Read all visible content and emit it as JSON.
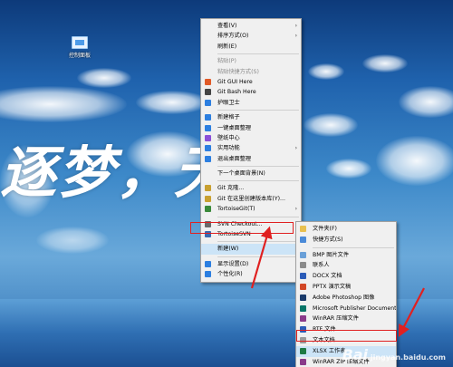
{
  "desktop": {
    "icon_label": "控制面板",
    "calligraphy_text": "逐梦，无"
  },
  "context_menu": [
    {
      "label": "查看(V)",
      "icon": "",
      "has_submenu": true
    },
    {
      "label": "排序方式(O)",
      "icon": "",
      "has_submenu": true
    },
    {
      "label": "刷新(E)",
      "icon": ""
    },
    {
      "type": "separator"
    },
    {
      "label": "粘贴(P)",
      "icon": "",
      "disabled": true
    },
    {
      "label": "粘贴快捷方式(S)",
      "icon": "",
      "disabled": true
    },
    {
      "label": "Git GUI Here",
      "icon": "git-gui-icon",
      "color": "#e05a28"
    },
    {
      "label": "Git Bash Here",
      "icon": "git-bash-icon",
      "color": "#444444"
    },
    {
      "label": "护眼卫士",
      "icon": "eye-guard-icon",
      "color": "#2d7fe0"
    },
    {
      "type": "separator"
    },
    {
      "label": "新建格子",
      "icon": "grid-icon",
      "color": "#2d7fe0"
    },
    {
      "label": "一键桌面整理",
      "icon": "desktop-organize-icon",
      "color": "#2d7fe0"
    },
    {
      "label": "壁纸中心",
      "icon": "wallpaper-icon",
      "color": "#8a4fd8"
    },
    {
      "label": "实用功能",
      "icon": "tools-icon",
      "color": "#2d7fe0",
      "has_submenu": true
    },
    {
      "label": "退出桌面整理",
      "icon": "exit-icon",
      "color": "#2d7fe0"
    },
    {
      "type": "separator"
    },
    {
      "label": "下一个桌面背景(N)",
      "icon": ""
    },
    {
      "type": "separator"
    },
    {
      "label": "Git 克隆...",
      "icon": "git-clone-icon",
      "color": "#c8a030"
    },
    {
      "label": "Git 在这里创建版本库(Y)...",
      "icon": "git-create-repo-icon",
      "color": "#c8a030"
    },
    {
      "label": "TortoiseGit(T)",
      "icon": "tortoisegit-icon",
      "color": "#3a8a3a",
      "has_submenu": true
    },
    {
      "type": "separator"
    },
    {
      "label": "SVN Checkout...",
      "icon": "svn-checkout-icon",
      "color": "#6a6a6a"
    },
    {
      "label": "TortoiseSVN",
      "icon": "tortoisesvn-icon",
      "color": "#3a6ab0",
      "has_submenu": true
    },
    {
      "type": "separator"
    },
    {
      "label": "新建(W)",
      "icon": "",
      "has_submenu": true,
      "highlighted": true
    },
    {
      "type": "separator"
    },
    {
      "label": "显示设置(D)",
      "icon": "display-icon",
      "color": "#2d7fe0"
    },
    {
      "label": "个性化(R)",
      "icon": "personalize-icon",
      "color": "#2d7fe0"
    }
  ],
  "new_submenu": [
    {
      "label": "文件夹(F)",
      "icon": "folder-icon",
      "color": "#e8c050"
    },
    {
      "label": "快捷方式(S)",
      "icon": "shortcut-icon",
      "color": "#4a8ad8"
    },
    {
      "type": "separator"
    },
    {
      "label": "BMP 图片文件",
      "icon": "bmp-file-icon",
      "color": "#6aa0d8"
    },
    {
      "label": "联系人",
      "icon": "contact-icon",
      "color": "#8a8a8a"
    },
    {
      "label": "DOCX 文档",
      "icon": "docx-file-icon",
      "color": "#2b5cb8"
    },
    {
      "label": "PPTX 演示文稿",
      "icon": "pptx-file-icon",
      "color": "#d24726"
    },
    {
      "label": "Adobe Photoshop 图像",
      "icon": "psd-file-icon",
      "color": "#1a3a6a"
    },
    {
      "label": "Microsoft Publisher Document",
      "icon": "publisher-file-icon",
      "color": "#077568"
    },
    {
      "label": "WinRAR 压缩文件",
      "icon": "rar-file-icon",
      "color": "#8a3a8a"
    },
    {
      "label": "RTF 文件",
      "icon": "rtf-file-icon",
      "color": "#2b5cb8"
    },
    {
      "label": "文本文档",
      "icon": "txt-file-icon",
      "color": "#9a9a9a"
    },
    {
      "label": "XLSX 工作表",
      "icon": "xlsx-file-icon",
      "color": "#1f7a44",
      "highlighted": true
    },
    {
      "label": "WinRAR ZIP 压缩文件",
      "icon": "zip-file-icon",
      "color": "#8a3a8a"
    }
  ],
  "watermark": {
    "brand": "Bai",
    "text": "jingyan.baidu.com"
  }
}
